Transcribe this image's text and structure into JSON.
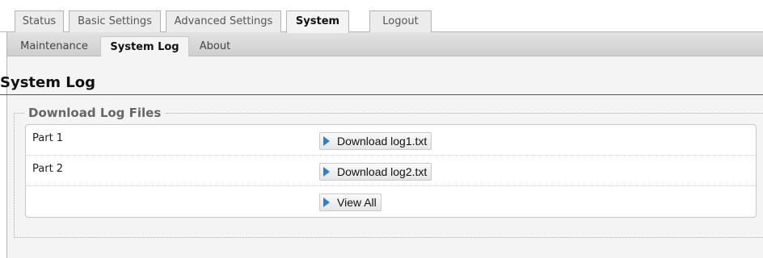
{
  "top_tabs": [
    {
      "label": "Status",
      "active": false
    },
    {
      "label": "Basic Settings",
      "active": false
    },
    {
      "label": "Advanced Settings",
      "active": false
    },
    {
      "label": "System",
      "active": true
    },
    {
      "label": "Logout",
      "active": false
    }
  ],
  "sub_tabs": [
    {
      "label": "Maintenance",
      "active": false
    },
    {
      "label": "System Log",
      "active": true
    },
    {
      "label": "About",
      "active": false
    }
  ],
  "page": {
    "title": "System Log"
  },
  "download_section": {
    "legend": "Download Log Files",
    "rows": [
      {
        "label": "Part 1",
        "button": "Download log1.txt",
        "icon": "play-icon"
      },
      {
        "label": "Part 2",
        "button": "Download log2.txt",
        "icon": "play-icon"
      },
      {
        "label": "",
        "button": "View All",
        "icon": "play-icon"
      }
    ]
  },
  "colors": {
    "accent_icon": "#2f7fc9",
    "panel_bg": "#f4f4f4",
    "tab_bar_bg": "#d9d9d9"
  }
}
